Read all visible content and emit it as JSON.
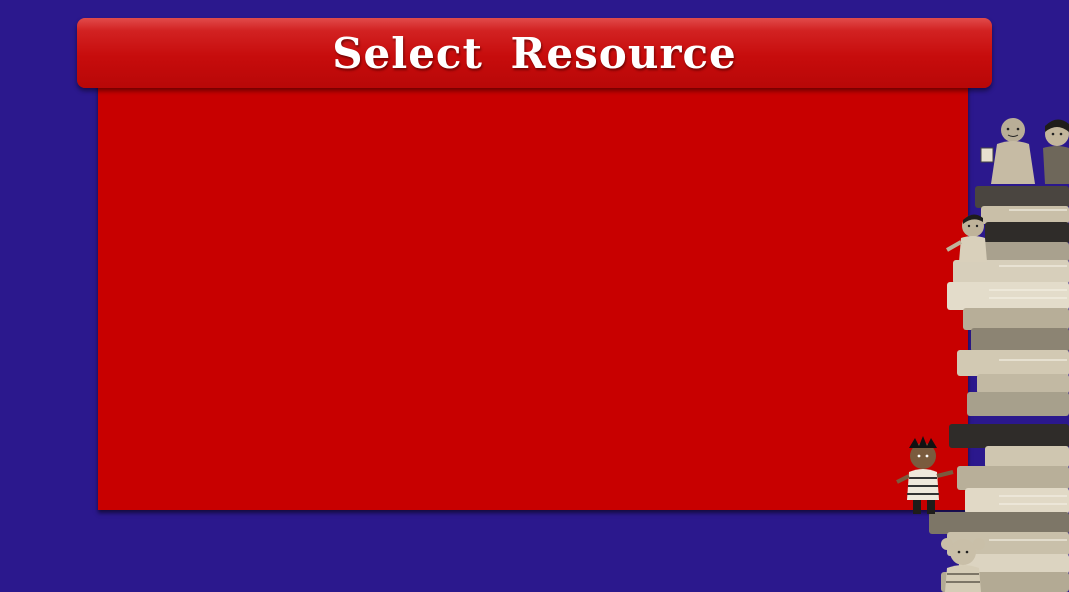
{
  "header": {
    "title": "Select Resource"
  },
  "colors": {
    "background": "#2b188d",
    "panel": "#c80000",
    "title_bar": "#c70c0c",
    "title_text": "#ffffff",
    "book_light": "#c9bfa8",
    "book_dark": "#3a3734"
  },
  "icons": {
    "decoration": "kids-on-books-stack-illustration"
  }
}
